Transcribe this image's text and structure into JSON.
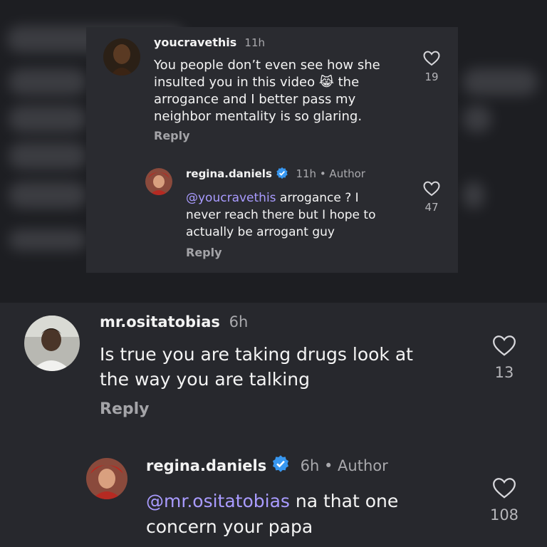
{
  "comments": [
    {
      "username": "youcravethis",
      "time": "11h",
      "text": "You people don’t even see how she insulted you in this video 😿 the arrogance and I better pass my neighbor mentality is so glaring.",
      "text_lines": [
        "You people don’t even see how she",
        "insulted you in this video 😹 the",
        "arrogance and I better pass my",
        "neighbor mentality is so glaring."
      ],
      "likes": "19",
      "reply_label": "Reply"
    },
    {
      "username": "regina.daniels",
      "time": "11h",
      "author_label": "• Author",
      "mention": "@youcravethis",
      "text_lines": [
        " arrogance ? I",
        "never reach there but I hope to",
        "actually be arrogant guy"
      ],
      "likes": "47",
      "reply_label": "Reply"
    },
    {
      "username": "mr.ositatobias",
      "time": "6h",
      "text_lines": [
        "Is true you are taking drugs look at",
        "the way you are talking"
      ],
      "likes": "13",
      "reply_label": "Reply"
    },
    {
      "username": "regina.daniels",
      "time": "6h",
      "author_label": "• Author",
      "mention": "@mr.ositatobias",
      "text_lines": [
        " na that one",
        "concern your papa"
      ],
      "likes": "108"
    }
  ],
  "colors": {
    "mention": "#a99bff",
    "verified": "#3897f0",
    "background": "#202125"
  },
  "icons": [
    "heart-outline-icon",
    "verified-badge-icon",
    "mention-at-icon"
  ]
}
